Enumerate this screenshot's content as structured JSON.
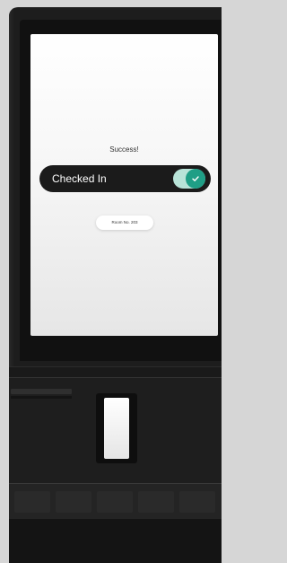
{
  "screen": {
    "status_text": "Success!",
    "toggle_label": "Checked In",
    "toggle_checked": true,
    "room_label": "Room No. 203"
  },
  "colors": {
    "kiosk_body": "#1d1d1d",
    "toggle_accent": "#1f9e86",
    "toggle_track": "#b8e3d8"
  },
  "icons": {
    "toggle_knob": "checkmark-icon"
  }
}
